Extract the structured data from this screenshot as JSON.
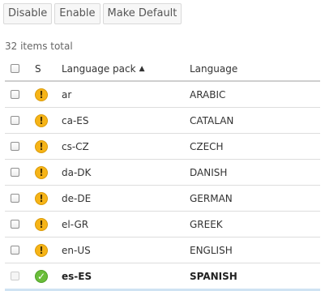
{
  "toolbar": {
    "disable_label": "Disable",
    "enable_label": "Enable",
    "make_default_label": "Make Default"
  },
  "summary": {
    "count_text": "32 items total"
  },
  "table": {
    "headers": {
      "status": "S",
      "pack": "Language pack",
      "language": "Language"
    },
    "sort_indicator": "▲",
    "rows": [
      {
        "pack": "ar",
        "language": "ARABIC",
        "status": "warning"
      },
      {
        "pack": "ca-ES",
        "language": "CATALAN",
        "status": "warning"
      },
      {
        "pack": "cs-CZ",
        "language": "CZECH",
        "status": "warning"
      },
      {
        "pack": "da-DK",
        "language": "DANISH",
        "status": "warning"
      },
      {
        "pack": "de-DE",
        "language": "GERMAN",
        "status": "warning"
      },
      {
        "pack": "el-GR",
        "language": "GREEK",
        "status": "warning"
      },
      {
        "pack": "en-US",
        "language": "ENGLISH",
        "status": "warning"
      },
      {
        "pack": "es-ES",
        "language": "SPANISH",
        "status": "ok"
      }
    ]
  },
  "icons": {
    "warning": "warning-icon",
    "ok": "check-circle-icon",
    "sort": "sort-ascending-icon"
  },
  "colors": {
    "warning": "#f6b417",
    "ok": "#6abd3a"
  }
}
